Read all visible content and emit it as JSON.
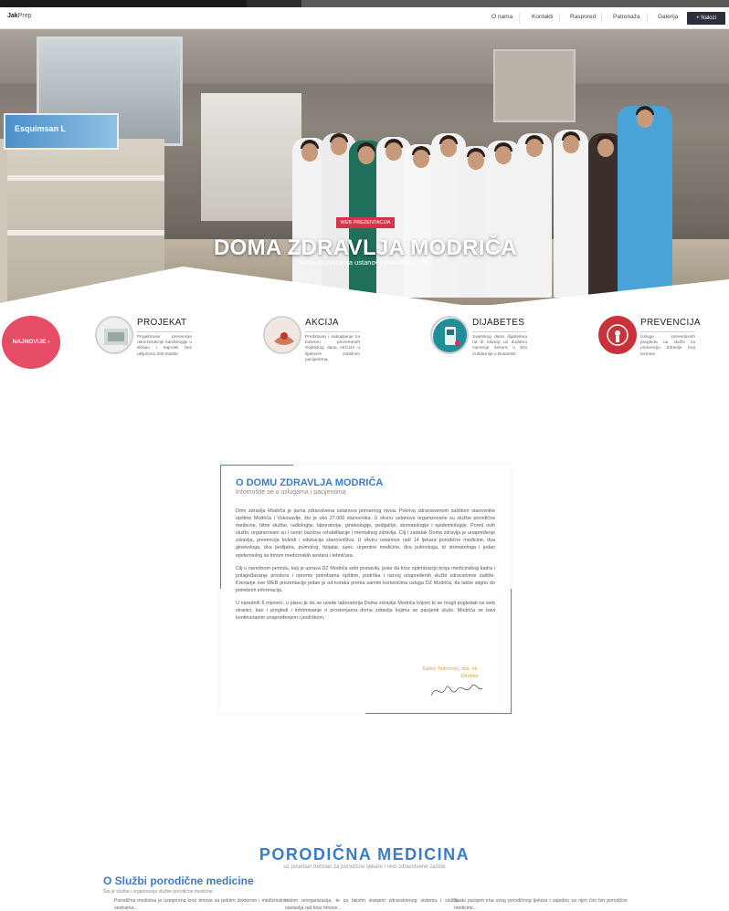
{
  "nav": {
    "logo_main": "Jak",
    "logo_rest": "Prep",
    "items": [
      "O nama",
      "Kontakti",
      "Raspored",
      "Patronaža",
      "Galerija"
    ],
    "button": "+ Nalozi"
  },
  "hero": {
    "poster": "Esquimsan L",
    "badge": "WEB PREZENTACIJA",
    "title": "DOMA ZDRAVLJA MODRIČA",
    "subtitle": "javna zdravstvena ustanova primarnog nivoa"
  },
  "features": {
    "najnovije": "NAJNOVIJE ›",
    "items": [
      {
        "title": "PROJEKAT",
        "text": "Projektovan prevencije rekonstrukcije kardiologije u sklopu i trajnosti bez uključeno 200 stubile"
      },
      {
        "title": "AKCIJA",
        "text": "Predstavaj i sakupljanje za bolesno privremenih Svjetskog dana AKCIJA u lijekovim stubilnim pacijentima."
      },
      {
        "title": "DIJABETES",
        "text": "Svjetskog dana dijabetesa na ih lokaciji uz dodatno mjerenje šećera u krvi Antidarnije u Bosanski."
      },
      {
        "title": "PREVENCIJA",
        "text": "Usluge preventivnih pregleda na službi za prevenciju Zdravlje broj termina"
      }
    ]
  },
  "about": {
    "title": "O DOMU ZDRAVLJA MODRIČA",
    "subtitle": "Informišite se o uslugama i pacijentima",
    "p1": "Dom zdravlja Modriča je javna zdravstvena ustanova primarnog nivoa. Pokriva zdravstvenom zaštitom stanovnike opštine Modriča i Vukosavlje, što je oko 27.000 stanovnika. U okviru ustanove organizovane su službe porodične medicine, hitne službe, radiologije, laboratorije, ginekologije, pedijatrije, stomatologije i epidemiologije. Pored ovih službi, organizovani su i centri bazične rehabilitacije i mentalnog zdravlja. Cilj i zadatak Doma zdravlja je unapređenje zdravlja, prevencija bolesti i edukacija stanovništva. U okviru ustanove radi 14 ljekara porodične medicine, dva ginekologa, dva pedijatra, pulmolog, fizijatar, spec. urgentne medicine, dva pulmologa, tri stomatologa i jedan epidemiolog sa timom medicinskih sestara i tehničara.",
    "p2": "Cilj u narednom periodu, koji je uprava DZ Modriča sebi postavila, jeste da kroz optimizaciju broja medicinskog kadra i prilagođavanje prostora i opreme potrebama opštine, podrška i razvoj unapređenih službi zdravstvene zaštite. Kreiranje ove WEB prezentacije jedan je od koraka prema samim korisnicima usluga DZ Modriča, da lakše stignu do potrebnih informacija.",
    "p3": "U narednih 6 mjeseci, u planu je da se uvede laboratorija Doma zdravlja Modriča kojom bi se mogli pogledati na web stranici, kao i pregledi i informisanje o prostorijama doma zdravlja kojima se pacijenti služe. Modriča se bavi kontinuiranim unapređenjem i podrškom.",
    "sign_name": "Darko Todorović, dipl. ek.",
    "sign_role": "Direktor"
  },
  "section": {
    "title": "PORODIČNA MEDICINA",
    "subtitle": "uz poseban tretman za porodične ljekare i nivo zdravstvene zaštite",
    "sub_title": "O Službi porodične medicine",
    "sub_sub": "Šta je službe i organizacija službe porodične medicine",
    "col1": "Porodična medicina je usmjerena kroz timove sa jednim doktorom i medicinskim sestrama...",
    "col2": "ostom reorganizacija, te sa takvim stanjem zdravstvenog sistema i služba nastavlja rad kroz timove...",
    "col3": "Svaki pacijent ima svog porodičnog ljekara i zajedno sa njim čini tim porodične medicine..."
  },
  "colors": {
    "accent": "#3d7cc4",
    "badge": "#d8334a",
    "najnovije": "#e64c65",
    "signature": "#e0a23c"
  }
}
